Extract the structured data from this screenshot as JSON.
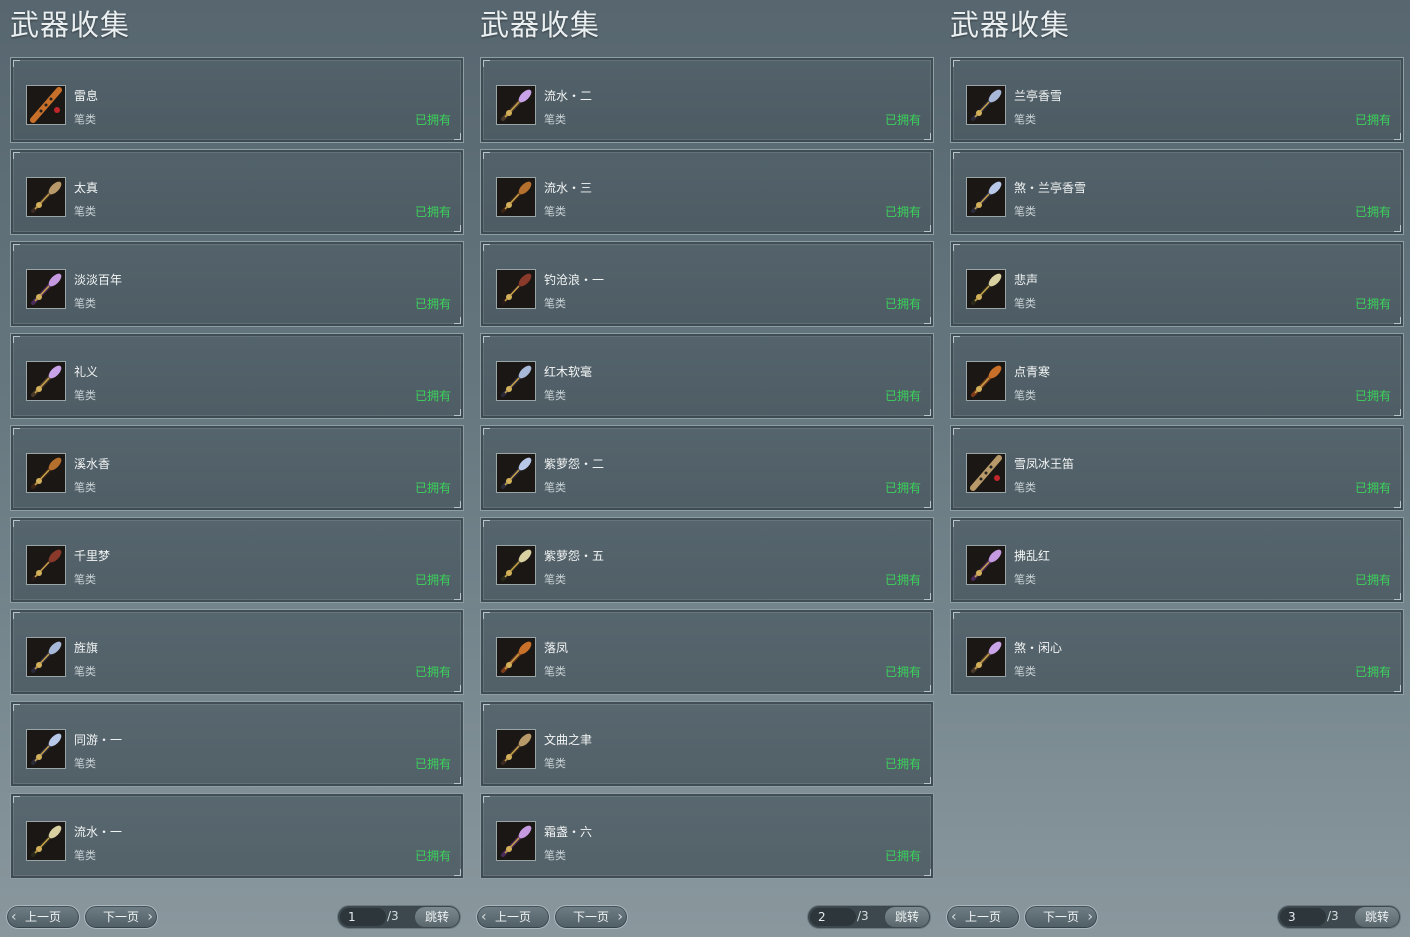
{
  "colors": {
    "owned": "#3ad35a",
    "panel": "#5b6a72"
  },
  "panels": [
    {
      "title": "武器收集",
      "items": [
        {
          "name": "雷息",
          "type": "笔类",
          "status": "已拥有",
          "icon": "weapon-flute-icon"
        },
        {
          "name": "太真",
          "type": "笔类",
          "status": "已拥有",
          "icon": "weapon-brush-icon"
        },
        {
          "name": "淡淡百年",
          "type": "笔类",
          "status": "已拥有",
          "icon": "weapon-brush-icon"
        },
        {
          "name": "礼义",
          "type": "笔类",
          "status": "已拥有",
          "icon": "weapon-brush-icon"
        },
        {
          "name": "溪水香",
          "type": "笔类",
          "status": "已拥有",
          "icon": "weapon-brush-icon"
        },
        {
          "name": "千里梦",
          "type": "笔类",
          "status": "已拥有",
          "icon": "weapon-brush-icon"
        },
        {
          "name": "旌旗",
          "type": "笔类",
          "status": "已拥有",
          "icon": "weapon-brush-icon"
        },
        {
          "name": "同游・一",
          "type": "笔类",
          "status": "已拥有",
          "icon": "weapon-brush-icon"
        },
        {
          "name": "流水・一",
          "type": "笔类",
          "status": "已拥有",
          "icon": "weapon-brush-icon"
        }
      ],
      "pager": {
        "prev": "上一页",
        "next": "下一页",
        "page": "1",
        "total": "/3",
        "jump": "跳转"
      }
    },
    {
      "title": "武器收集",
      "items": [
        {
          "name": "流水・二",
          "type": "笔类",
          "status": "已拥有",
          "icon": "weapon-brush-icon"
        },
        {
          "name": "流水・三",
          "type": "笔类",
          "status": "已拥有",
          "icon": "weapon-brush-icon"
        },
        {
          "name": "钓沧浪・一",
          "type": "笔类",
          "status": "已拥有",
          "icon": "weapon-brush-icon"
        },
        {
          "name": "红木软毫",
          "type": "笔类",
          "status": "已拥有",
          "icon": "weapon-brush-icon"
        },
        {
          "name": "紫萝怨・二",
          "type": "笔类",
          "status": "已拥有",
          "icon": "weapon-brush-icon"
        },
        {
          "name": "紫萝怨・五",
          "type": "笔类",
          "status": "已拥有",
          "icon": "weapon-brush-icon"
        },
        {
          "name": "落凤",
          "type": "笔类",
          "status": "已拥有",
          "icon": "weapon-brush-icon"
        },
        {
          "name": "文曲之聿",
          "type": "笔类",
          "status": "已拥有",
          "icon": "weapon-brush-icon"
        },
        {
          "name": "霜盏・六",
          "type": "笔类",
          "status": "已拥有",
          "icon": "weapon-brush-icon"
        }
      ],
      "pager": {
        "prev": "上一页",
        "next": "下一页",
        "page": "2",
        "total": "/3",
        "jump": "跳转"
      }
    },
    {
      "title": "武器收集",
      "items": [
        {
          "name": "兰亭香雪",
          "type": "笔类",
          "status": "已拥有",
          "icon": "weapon-brush-icon"
        },
        {
          "name": "煞・兰亭香雪",
          "type": "笔类",
          "status": "已拥有",
          "icon": "weapon-brush-icon"
        },
        {
          "name": "悲声",
          "type": "笔类",
          "status": "已拥有",
          "icon": "weapon-brush-icon"
        },
        {
          "name": "点青寒",
          "type": "笔类",
          "status": "已拥有",
          "icon": "weapon-brush-icon"
        },
        {
          "name": "雪凤冰王笛",
          "type": "笔类",
          "status": "已拥有",
          "icon": "weapon-flute-icon"
        },
        {
          "name": "拂乱红",
          "type": "笔类",
          "status": "已拥有",
          "icon": "weapon-brush-icon"
        },
        {
          "name": "煞・闲心",
          "type": "笔类",
          "status": "已拥有",
          "icon": "weapon-brush-icon"
        }
      ],
      "pager": {
        "prev": "上一页",
        "next": "下一页",
        "page": "3",
        "total": "/3",
        "jump": "跳转"
      }
    }
  ]
}
